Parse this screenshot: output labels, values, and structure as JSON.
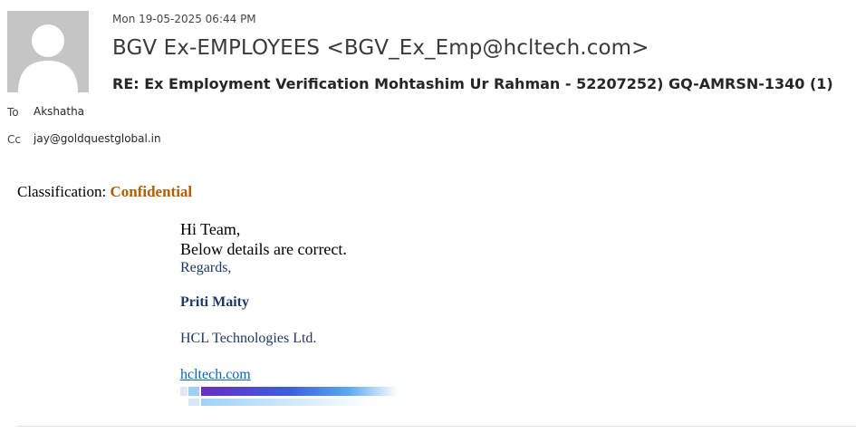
{
  "header": {
    "date": "Mon 19-05-2025 06:44 PM",
    "sender": "BGV Ex-EMPLOYEES <BGV_Ex_Emp@hcltech.com>",
    "subject": "RE: Ex Employment Verification Mohtashim Ur Rahman -  52207252) GQ-AMRSN-1340 (1)",
    "to_label": "To",
    "to_value": "Akshatha",
    "cc_label": "Cc",
    "cc_value": "jay@goldquestglobal.in",
    "avatar_icon": "person-silhouette-icon"
  },
  "body": {
    "classification_label": "Classification: ",
    "classification_value": "Confidential",
    "greeting": "Hi Team,",
    "line2": "Below details are correct.",
    "regards": "Regards,",
    "signature_name": "Priti Maity",
    "company": "HCL Technologies Ltd.",
    "website": "hcltech.com",
    "logo_icon": "hcltech-gradient-bar-icon"
  },
  "colors": {
    "classification": "#b35c00",
    "signature": "#1f3864",
    "link": "#0563c1",
    "avatar_bg": "#c5c5c5"
  }
}
